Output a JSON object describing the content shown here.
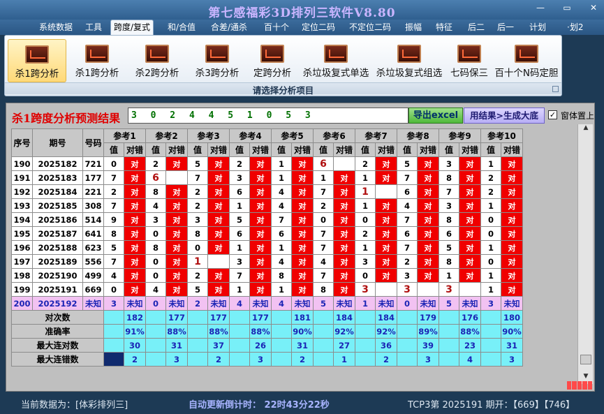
{
  "window": {
    "title": "第七感福彩3D排列三软件V8.80",
    "buttons": [
      "—",
      "▭",
      "✕"
    ]
  },
  "menu": [
    {
      "label": "系统数据"
    },
    {
      "label": "工具"
    },
    {
      "label": "跨度/复式",
      "active": true
    },
    {
      "label": "和/合值"
    },
    {
      "label": "合差/通杀"
    },
    {
      "label": "百十个"
    },
    {
      "label": "定位二码"
    },
    {
      "label": "不定位二码"
    },
    {
      "label": "振幅"
    },
    {
      "label": "特征"
    },
    {
      "label": "后二"
    },
    {
      "label": "后一"
    },
    {
      "label": "计划"
    },
    {
      "label": "·划2"
    }
  ],
  "ribbon": {
    "buttons": [
      {
        "label": "杀1跨分析",
        "active": true
      },
      {
        "label": "杀1跨分析"
      },
      {
        "label": "杀2跨分析"
      },
      {
        "label": "杀3跨分析"
      },
      {
        "label": "定跨分析"
      },
      {
        "label": "杀垃圾复式单选"
      },
      {
        "label": "杀垃圾复式组选"
      },
      {
        "label": "七码保三"
      },
      {
        "label": "百十个N码定胆"
      }
    ],
    "caption": "请选择分析项目"
  },
  "result": {
    "label": "杀1跨度分析预测结果",
    "value": "3 0 2 4 4 5 1 0 5 3",
    "export_button": "导出excel",
    "generate_button": "用结果>生成大底",
    "pin_checkbox_label": "窗体置上",
    "pin_checked": true
  },
  "table": {
    "headers": {
      "seq": "序号",
      "period": "期号",
      "number": "号码",
      "refs": [
        "参考1",
        "参考2",
        "参考3",
        "参考4",
        "参考5",
        "参考6",
        "参考7",
        "参考8",
        "参考9",
        "参考10"
      ],
      "val": "值",
      "hit": "对错"
    },
    "hit_text": "对",
    "rows": [
      {
        "seq": "190",
        "period": "2025182",
        "num": "721",
        "vals": [
          0,
          2,
          5,
          2,
          1,
          6,
          2,
          5,
          3,
          1
        ],
        "hits": [
          1,
          1,
          1,
          1,
          1,
          0,
          1,
          1,
          1,
          1
        ]
      },
      {
        "seq": "191",
        "period": "2025183",
        "num": "177",
        "vals": [
          7,
          6,
          7,
          3,
          1,
          1,
          1,
          7,
          8,
          2
        ],
        "hits": [
          1,
          0,
          1,
          1,
          1,
          1,
          1,
          1,
          1,
          1
        ]
      },
      {
        "seq": "192",
        "period": "2025184",
        "num": "221",
        "vals": [
          2,
          8,
          2,
          6,
          4,
          7,
          1,
          6,
          7,
          2
        ],
        "hits": [
          1,
          1,
          1,
          1,
          1,
          1,
          0,
          1,
          1,
          1
        ]
      },
      {
        "seq": "193",
        "period": "2025185",
        "num": "308",
        "vals": [
          7,
          4,
          2,
          1,
          4,
          2,
          1,
          4,
          3,
          1
        ],
        "hits": [
          1,
          1,
          1,
          1,
          1,
          1,
          1,
          1,
          1,
          1
        ]
      },
      {
        "seq": "194",
        "period": "2025186",
        "num": "514",
        "vals": [
          9,
          3,
          3,
          5,
          7,
          0,
          0,
          7,
          8,
          0
        ],
        "hits": [
          1,
          1,
          1,
          1,
          1,
          1,
          1,
          1,
          1,
          1
        ]
      },
      {
        "seq": "195",
        "period": "2025187",
        "num": "641",
        "vals": [
          8,
          0,
          8,
          6,
          6,
          7,
          2,
          6,
          6,
          0
        ],
        "hits": [
          1,
          1,
          1,
          1,
          1,
          1,
          1,
          1,
          1,
          1
        ]
      },
      {
        "seq": "196",
        "period": "2025188",
        "num": "623",
        "vals": [
          5,
          8,
          0,
          1,
          1,
          7,
          1,
          7,
          5,
          1
        ],
        "hits": [
          1,
          1,
          1,
          1,
          1,
          1,
          1,
          1,
          1,
          1
        ]
      },
      {
        "seq": "197",
        "period": "2025189",
        "num": "556",
        "vals": [
          7,
          0,
          1,
          3,
          4,
          4,
          3,
          2,
          8,
          0
        ],
        "hits": [
          1,
          1,
          0,
          1,
          1,
          1,
          1,
          1,
          1,
          1
        ]
      },
      {
        "seq": "198",
        "period": "2025190",
        "num": "499",
        "vals": [
          4,
          0,
          2,
          7,
          8,
          7,
          0,
          3,
          1,
          1
        ],
        "hits": [
          1,
          1,
          1,
          1,
          1,
          1,
          1,
          1,
          1,
          1
        ]
      },
      {
        "seq": "199",
        "period": "2025191",
        "num": "669",
        "vals": [
          0,
          4,
          5,
          1,
          1,
          8,
          3,
          3,
          3,
          1
        ],
        "hits": [
          1,
          1,
          1,
          1,
          1,
          1,
          0,
          0,
          0,
          1
        ]
      }
    ],
    "pred": {
      "seq": "200",
      "period": "2025192",
      "num": "未知",
      "vals": [
        3,
        0,
        2,
        4,
        4,
        5,
        1,
        0,
        5,
        3
      ],
      "hit_text": "未知"
    },
    "stats": [
      {
        "label": "对次数",
        "values": [
          "182",
          "177",
          "177",
          "177",
          "181",
          "184",
          "184",
          "179",
          "176",
          "180"
        ]
      },
      {
        "label": "准确率",
        "values": [
          "91%",
          "88%",
          "88%",
          "88%",
          "90%",
          "92%",
          "92%",
          "89%",
          "88%",
          "90%"
        ]
      },
      {
        "label": "最大连对数",
        "values": [
          "30",
          "31",
          "37",
          "26",
          "31",
          "27",
          "36",
          "39",
          "23",
          "31"
        ]
      },
      {
        "label": "最大连错数",
        "values": [
          "2",
          "3",
          "2",
          "3",
          "2",
          "1",
          "2",
          "3",
          "4",
          "3"
        ]
      }
    ]
  },
  "status": {
    "current_data": "当前数据为：[体彩排列三]",
    "countdown": "自动更新倒计时：  22时43分22秒",
    "tcp3": "TCP3第  2025191  期开：【669】【746】"
  }
}
